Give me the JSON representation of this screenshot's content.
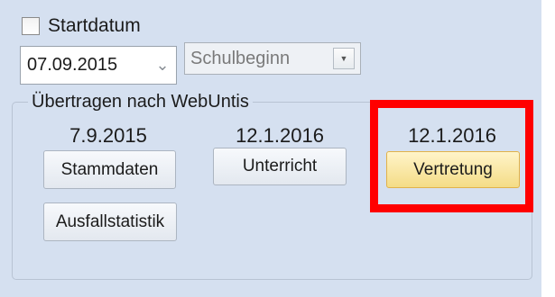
{
  "startdatum": {
    "label": "Startdatum",
    "checked": false
  },
  "date_field": {
    "value": "07.09.2015",
    "chevron_icon": "chevron-down-icon"
  },
  "start_select": {
    "value": "Schulbeginn",
    "dropdown_icon": "dropdown-arrow-icon"
  },
  "transfer_group": {
    "title": "Übertragen nach WebUntis",
    "columns": [
      {
        "date": "7.9.2015",
        "button": "Stammdaten"
      },
      {
        "date": "12.1.2016",
        "button": "Unterricht"
      },
      {
        "date": "12.1.2016",
        "button": "Vertretung"
      }
    ],
    "extra_button": "Ausfallstatistik"
  },
  "colors": {
    "panel_bg": "#d5e0f0",
    "highlight": "#ff0000",
    "active_button": "#f4dc86"
  }
}
